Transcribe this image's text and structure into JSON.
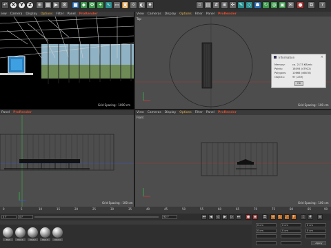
{
  "toolbar": {
    "axis_x": "X",
    "axis_y": "Y",
    "axis_z": "Z"
  },
  "viewport_tl": {
    "menu": [
      "iew",
      "Camera",
      "Display",
      "Options",
      "Filter",
      "Panel",
      "ProRender"
    ],
    "grid_spacing": "Grid Spacing : 1000 cm"
  },
  "viewport_tr": {
    "menu": [
      "View",
      "Cameras",
      "Display",
      "Options",
      "Filter",
      "Panel",
      "ProRender"
    ],
    "label": "Top",
    "grid_spacing": "Grid Spacing : 100 cm"
  },
  "viewport_bl": {
    "menu": [
      "Panel",
      "ProRender"
    ],
    "grid_spacing": "Grid Spacing : 100 cm"
  },
  "viewport_br": {
    "menu": [
      "View",
      "Cameras",
      "Display",
      "Options",
      "Filter",
      "Panel",
      "ProRender"
    ],
    "label": "Front",
    "grid_spacing": "Grid Spacing : 100 cm"
  },
  "info_dialog": {
    "title": "Information",
    "rows": [
      {
        "label": "Memory:",
        "value": "ca. 2173 KB/mb"
      },
      {
        "label": "Points:",
        "value": "18093 (47922)"
      },
      {
        "label": "Polygons:",
        "value": "10666 (46878)"
      },
      {
        "label": "Objects:",
        "value": "97 (239)"
      }
    ],
    "ok_label": "OK"
  },
  "timeline": {
    "ticks": [
      "0",
      "5",
      "10",
      "15",
      "20",
      "25",
      "30",
      "35",
      "40",
      "45",
      "50",
      "55",
      "60",
      "65",
      "70",
      "75",
      "80",
      "85",
      "90"
    ],
    "current_frame": "0 F",
    "end_frame": "0 F",
    "max_frame": "90 F"
  },
  "materials": {
    "names": [
      "Mat",
      "Mat.1",
      "Mat.2",
      "Mat.3",
      "Mat.4"
    ],
    "colors": {
      "accent": "#e6b04a",
      "prorender": "#e04a2a",
      "axis_y": "#3ab84a",
      "axis_x": "#d03a3a",
      "axis_z": "#3a5ad0"
    }
  },
  "attributes": {
    "fields": [
      "0 cm",
      "0 cm",
      "0 cm",
      "0 cm",
      "0 cm",
      "0 cm"
    ],
    "apply_label": "Apply"
  }
}
